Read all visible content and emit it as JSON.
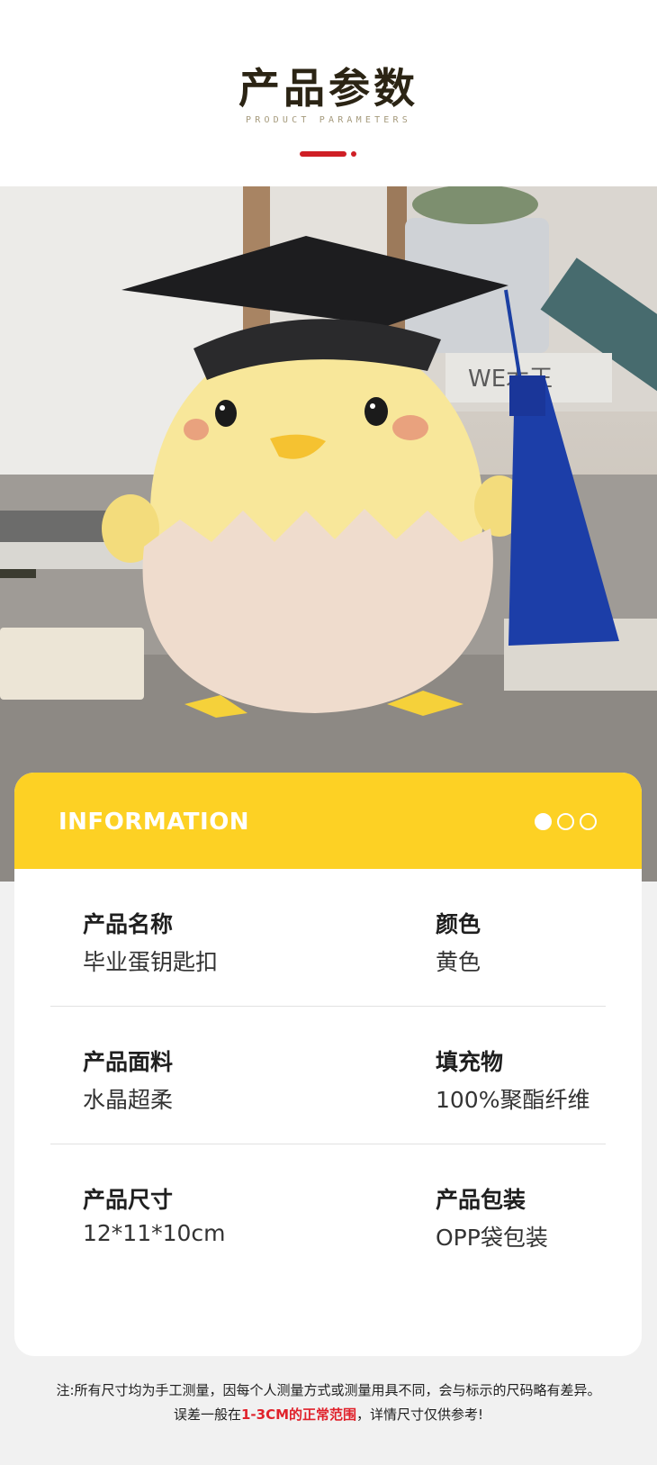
{
  "header": {
    "title": "产品参数",
    "subtitle": "PRODUCT PARAMETERS"
  },
  "photo": {
    "subject": "graduation-chick-plush-image",
    "background_book_text": "WE木王"
  },
  "info": {
    "heading": "INFORMATION",
    "pager": {
      "total": 3,
      "active": 1
    },
    "rows": [
      {
        "left_label": "产品名称",
        "left_value": "毕业蛋钥匙扣",
        "right_label": "颜色",
        "right_value": "黄色"
      },
      {
        "left_label": "产品面料",
        "left_value": "水晶超柔",
        "right_label": "填充物",
        "right_value": "100%聚酯纤维"
      },
      {
        "left_label": "产品尺寸",
        "left_value": "12*11*10cm",
        "right_label": "产品包装",
        "right_value": "OPP袋包装"
      }
    ]
  },
  "footer": {
    "line1": "注:所有尺寸均为手工测量，因每个人测量方式或测量用具不同，会与标示的尺码略有差异。",
    "line2_prefix": "误差一般在",
    "line2_highlight": "1-3CM的正常范围",
    "line2_suffix": "，详情尺寸仅供参考!"
  },
  "colors": {
    "accent_yellow": "#fdd124",
    "accent_red": "#cf1f25",
    "title_dark": "#2b2414",
    "highlight_red": "#e0222b"
  }
}
